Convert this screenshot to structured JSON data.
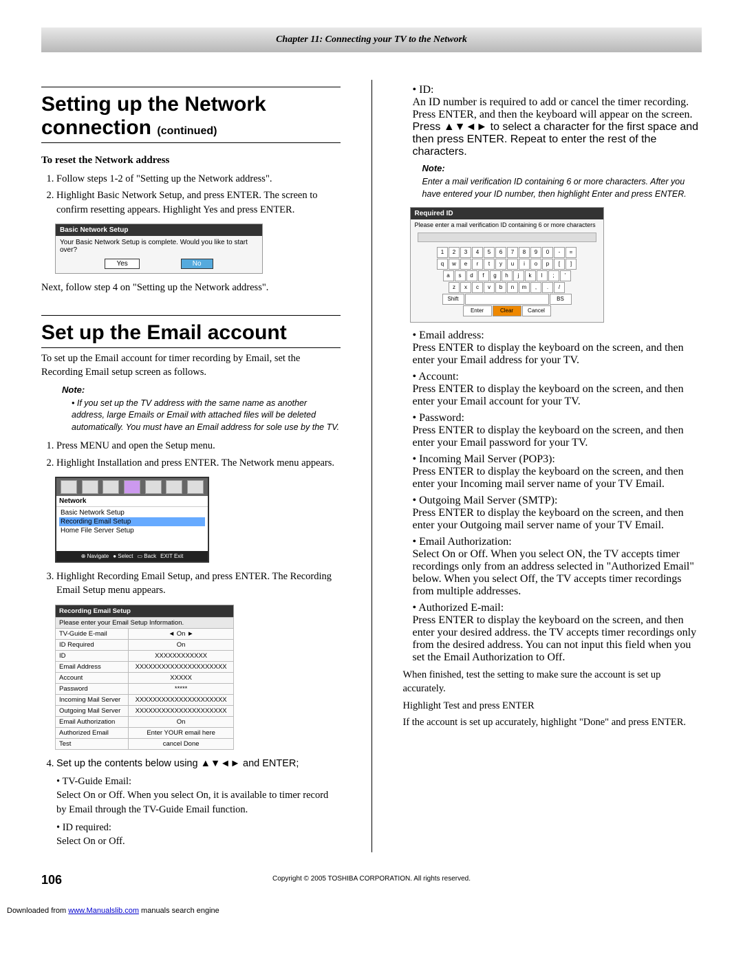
{
  "chapter": "Chapter 11: Connecting your TV to the Network",
  "h1": "Setting up the Network connection",
  "h1cont": "(continued)",
  "reset_heading": "To reset the Network address",
  "reset_steps": [
    "Follow steps 1-2 of \"Setting up the Network address\".",
    "Highlight Basic Network Setup, and press ENTER. The screen to confirm resetting appears. Highlight Yes and press ENTER."
  ],
  "dialog1": {
    "title": "Basic Network Setup",
    "msg": "Your Basic Network Setup is complete. Would you like to start over?",
    "yes": "Yes",
    "no": "No"
  },
  "after_dialog": "Next, follow step 4 on \"Setting up the Network address\".",
  "h2": "Set up the Email account",
  "email_intro": "To set up the Email account for timer recording by Email, set the  Recording Email setup screen as follows.",
  "note_label": "Note:",
  "email_note": "If you set up the TV address with the same name as another address, large Emails or Email with attached files will be deleted automatically. You must have an Email address for sole use by the TV.",
  "email_steps": [
    "Press MENU and open the Setup menu.",
    "Highlight Installation and press ENTER. The Network menu appears."
  ],
  "menu": {
    "title": "Network",
    "items": [
      "Basic Network Setup",
      "Recording Email Setup",
      "Home File Server Setup"
    ],
    "foot": [
      "Navigate",
      "Select",
      "Back",
      "Exit"
    ]
  },
  "step3": "Highlight Recording Email Setup, and press ENTER. The Recording Email Setup menu appears.",
  "setup": {
    "title": "Recording Email Setup",
    "subtitle": "Please enter your Email Setup Information.",
    "rows": [
      [
        "TV-Guide E-mail",
        "◄      On      ►"
      ],
      [
        "ID Required",
        "On"
      ],
      [
        "ID",
        "XXXXXXXXXXXX"
      ],
      [
        "Email Address",
        "XXXXXXXXXXXXXXXXXXXXX"
      ],
      [
        "Account",
        "XXXXX"
      ],
      [
        "Password",
        "*****"
      ],
      [
        "Incoming Mail Server",
        "XXXXXXXXXXXXXXXXXXXXX"
      ],
      [
        "Outgoing Mail Server",
        "XXXXXXXXXXXXXXXXXXXXX"
      ],
      [
        "Email Authorization",
        "On"
      ],
      [
        "Authorized Email",
        "Enter YOUR email here"
      ],
      [
        "Test",
        "cancel          Done"
      ]
    ]
  },
  "step4_intro": "Set up the contents below using ▲▼◄► and ENTER;",
  "tvguide": {
    "h": "TV-Guide Email:",
    "b": "Select On or Off. When you select On, it is available to timer record by Email through the TV-Guide Email function."
  },
  "idreq": {
    "h": "ID required:",
    "b": "Select On or Off."
  },
  "id": {
    "h": "ID:",
    "b1": "An ID number is required to add or cancel the timer recording. Press ENTER, and then the keyboard will appear on the screen.",
    "b2": "Press ▲▼◄► to select a character for the first space and then press ENTER. Repeat to enter the rest of the characters."
  },
  "id_note": "Enter a mail verification ID containing 6 or more characters. After you have entered your ID number, then highlight Enter and press ENTER.",
  "kb": {
    "title": "Required ID",
    "msg": "Please enter a mail verification ID containing 6 or more characters",
    "row1": [
      "1",
      "2",
      "3",
      "4",
      "5",
      "6",
      "7",
      "8",
      "9",
      "0",
      "-",
      "="
    ],
    "row2": [
      "q",
      "w",
      "e",
      "r",
      "t",
      "y",
      "u",
      "i",
      "o",
      "p",
      "[",
      "]"
    ],
    "row3": [
      "a",
      "s",
      "d",
      "f",
      "g",
      "h",
      "j",
      "k",
      "l",
      ";",
      "'"
    ],
    "row4": [
      "z",
      "x",
      "c",
      "v",
      "b",
      "n",
      "m",
      ",",
      ".",
      "/"
    ],
    "shift": "Shift",
    "bs": "BS",
    "enter": "Enter",
    "clear": "Clear",
    "cancel": "Cancel"
  },
  "emailaddr": {
    "h": "Email address:",
    "b": "Press ENTER to display the keyboard on the screen, and then enter your Email address for your TV."
  },
  "account": {
    "h": "Account:",
    "b": "Press ENTER to display the keyboard on the screen, and then enter your Email account for your TV."
  },
  "password": {
    "h": "Password:",
    "b": "Press ENTER to display the keyboard on the screen, and then enter your Email password for your TV."
  },
  "incoming": {
    "h": "Incoming Mail Server (POP3):",
    "b": "Press ENTER to display the keyboard on the screen, and then enter your Incoming mail server name of your TV Email."
  },
  "outgoing": {
    "h": "Outgoing Mail Server (SMTP):",
    "b": "Press ENTER to display the keyboard on the screen, and then enter your Outgoing mail server name of your TV Email."
  },
  "auth": {
    "h": "Email Authorization:",
    "b": "Select On or Off. When you select ON, the TV accepts timer recordings only from an address selected in \"Authorized Email\" below. When you select Off, the TV accepts timer recordings from multiple addresses."
  },
  "authemail": {
    "h": "Authorized E-mail:",
    "b": "Press ENTER to display the keyboard on the screen, and then enter your desired address. the TV accepts timer recordings only from the desired address. You can not input this field when you set the Email Authorization to Off."
  },
  "finish1": "When finished, test the setting to make sure the account is set up accurately.",
  "finish2": "Highlight Test and press ENTER",
  "finish3": "If the account is set up accurately, highlight \"Done\" and press ENTER.",
  "pagenum": "106",
  "copyright": "Copyright © 2005 TOSHIBA CORPORATION. All rights reserved.",
  "dl_prefix": "Downloaded from ",
  "dl_link": "www.Manualslib.com",
  "dl_suffix": " manuals search engine"
}
